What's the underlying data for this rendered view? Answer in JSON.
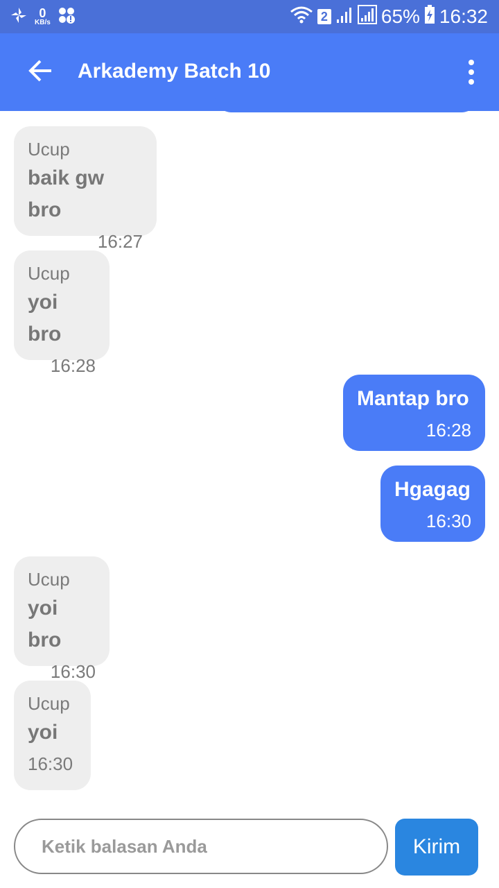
{
  "status_bar": {
    "speed_value": "0",
    "speed_unit": "KB/s",
    "sim_slot": "2",
    "battery": "65%",
    "time": "16:32"
  },
  "header": {
    "title": "Arkademy Batch 10"
  },
  "messages": [
    {
      "direction": "in",
      "sender": "Ucup",
      "text": "baik gw bro",
      "time": "16:27"
    },
    {
      "direction": "in",
      "sender": "Ucup",
      "text": "yoi bro",
      "time": "16:28"
    },
    {
      "direction": "out",
      "text": "Mantap bro",
      "time": "16:28"
    },
    {
      "direction": "out",
      "text": "Hgagag",
      "time": "16:30"
    },
    {
      "direction": "in",
      "sender": "Ucup",
      "text": "yoi bro",
      "time": "16:30"
    },
    {
      "direction": "in",
      "sender": "Ucup",
      "text": "yoi",
      "time": "16:30"
    }
  ],
  "composer": {
    "placeholder": "Ketik balasan Anda",
    "value": "",
    "send_label": "Kirim"
  },
  "colors": {
    "status_bar": "#4a70d8",
    "app_bar": "#4a7cf7",
    "incoming_bubble": "#eeeeee",
    "outgoing_bubble": "#4a7cf7",
    "send_button": "#2a86e0"
  }
}
